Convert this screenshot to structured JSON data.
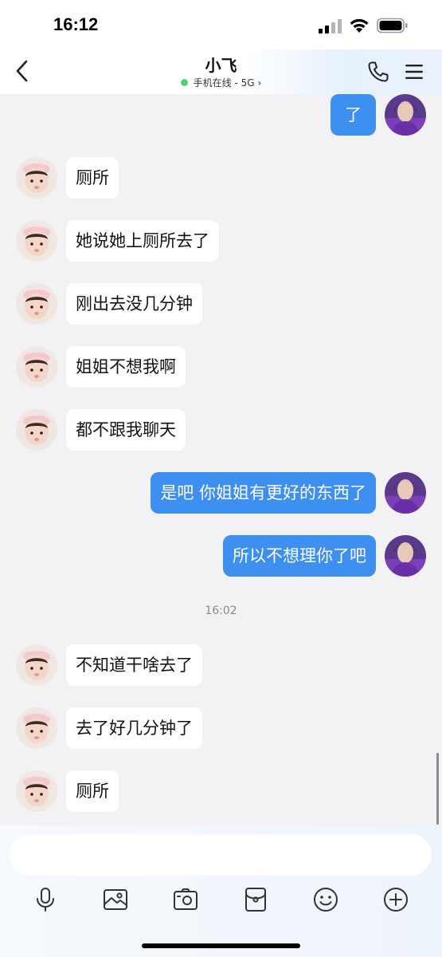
{
  "status_bar": {
    "time": "16:12"
  },
  "header": {
    "title": "小飞",
    "status": "手机在线 - 5G",
    "status_dot_color": "#4fd27a"
  },
  "messages": [
    {
      "from": "me",
      "text": "了"
    },
    {
      "from": "peer",
      "text": "厕所"
    },
    {
      "from": "peer",
      "text": "她说她上厕所去了"
    },
    {
      "from": "peer",
      "text": "刚出去没几分钟"
    },
    {
      "from": "peer",
      "text": "姐姐不想我啊"
    },
    {
      "from": "peer",
      "text": "都不跟我聊天"
    },
    {
      "from": "me",
      "text": "是吧 你姐姐有更好的东西了"
    },
    {
      "from": "me",
      "text": "所以不想理你了吧"
    },
    {
      "timestamp": "16:02"
    },
    {
      "from": "peer",
      "text": "不知道干啥去了"
    },
    {
      "from": "peer",
      "text": "去了好几分钟了"
    },
    {
      "from": "peer",
      "text": "厕所"
    }
  ],
  "input": {
    "placeholder": ""
  },
  "toolbar": {
    "icons": [
      "microphone-icon",
      "image-icon",
      "camera-icon",
      "red-envelope-icon",
      "emoji-icon",
      "plus-icon"
    ]
  },
  "colors": {
    "outgoing_bubble": "#3d8ff0",
    "incoming_bubble": "#ffffff",
    "background": "#f2f2f4"
  }
}
